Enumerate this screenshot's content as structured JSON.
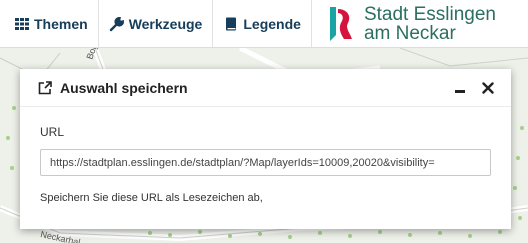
{
  "nav": {
    "themes_label": "Themen",
    "tools_label": "Werkzeuge",
    "legend_label": "Legende"
  },
  "logo": {
    "line1": "Stadt Esslingen",
    "line2": "am Neckar"
  },
  "map": {
    "street_label_1": "Bog",
    "street_label_2": "Neckarhal"
  },
  "dialog": {
    "title": "Auswahl speichern",
    "url_label": "URL",
    "url_value": "https://stadtplan.esslingen.de/stadtplan/?Map/layerIds=10009,20020&visibility=",
    "hint": "Speichern Sie diese URL als Lesezeichen ab,"
  },
  "colors": {
    "nav_text": "#163d59",
    "brand_green": "#2b6f5e",
    "brand_teal": "#1aa3a3",
    "brand_red": "#d4143c"
  }
}
